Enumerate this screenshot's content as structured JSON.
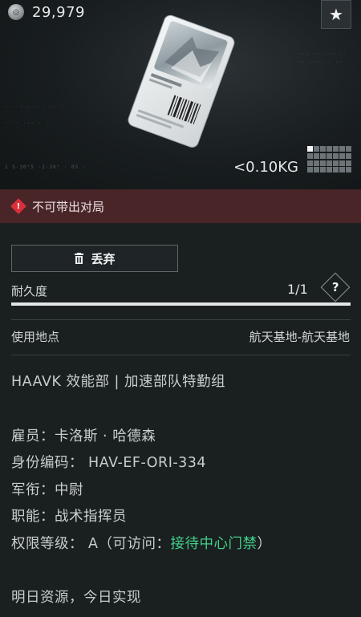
{
  "header": {
    "currency_icon": "coin-icon",
    "currency_value": "29,979",
    "favorite_icon": "star-icon",
    "weight": "<0.10KG",
    "grid_cells_total": 28,
    "grid_cells_highlighted": 1
  },
  "warning": {
    "icon": "warning-diamond-icon",
    "text": "不可带出对局"
  },
  "actions": {
    "discard_label": "丢弃",
    "discard_icon": "trash-icon"
  },
  "durability": {
    "label": "耐久度",
    "value": "1/1",
    "fraction": 1.0,
    "help_label": "?"
  },
  "location": {
    "label": "使用地点",
    "value": "航天基地-航天基地"
  },
  "description": {
    "org": "HAAVK 效能部 | 加速部队特勤组",
    "employee": "雇员：卡洛斯 · 哈德森",
    "id_code": "身份编码： HAV-EF-ORI-334",
    "rank": "军衔：中尉",
    "role": "职能：战术指挥员",
    "access_prefix": "权限等级： A（可访问：",
    "access_highlight": "接待中心门禁",
    "access_suffix": "）",
    "slogan": "明日资源，今日实现"
  },
  "colors": {
    "warning_bg": "#4a2528",
    "warning_icon": "#d9303a",
    "highlight_green": "#43d08a",
    "background": "#1a1f20"
  }
}
